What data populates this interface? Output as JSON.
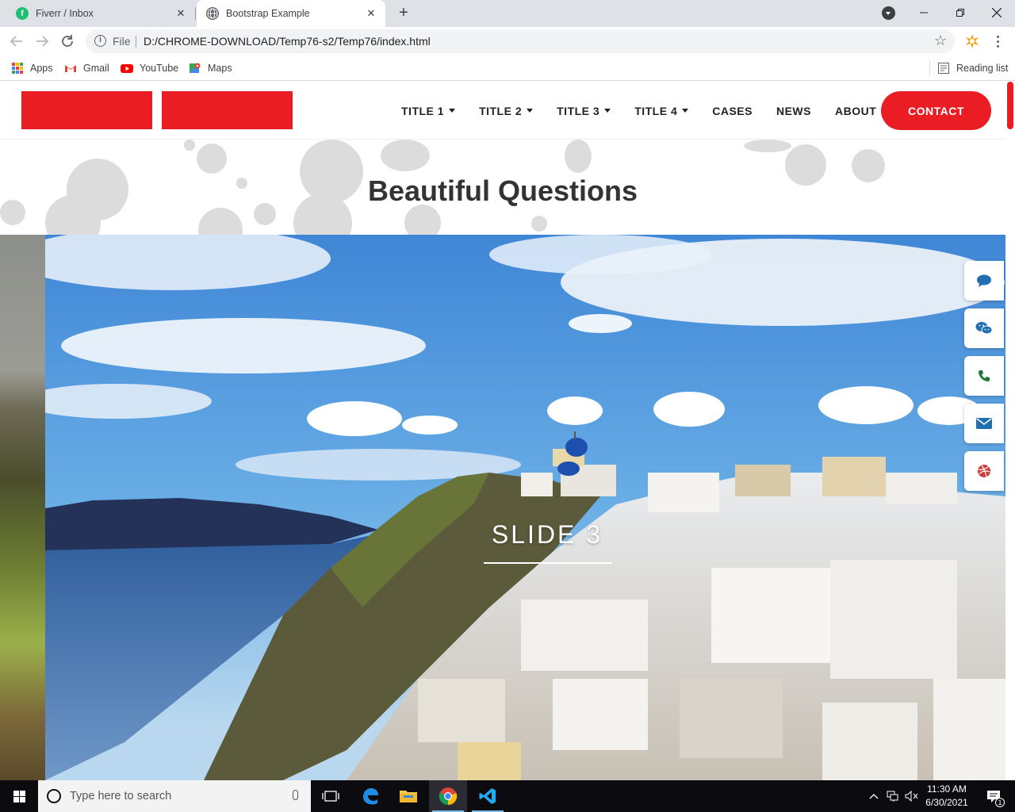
{
  "browser": {
    "tabs": [
      {
        "title": "Fiverr / Inbox",
        "icon": "fiverr-icon"
      },
      {
        "title": "Bootstrap Example",
        "icon": "globe-icon"
      }
    ],
    "address": {
      "scheme_label": "File",
      "url": "D:/CHROME-DOWNLOAD/Temp76-s2/Temp76/index.html"
    },
    "bookmarks": [
      {
        "label": "Apps",
        "icon": "apps-grid-icon"
      },
      {
        "label": "Gmail",
        "icon": "gmail-icon"
      },
      {
        "label": "YouTube",
        "icon": "youtube-icon"
      },
      {
        "label": "Maps",
        "icon": "maps-icon"
      }
    ],
    "reading_list": "Reading list"
  },
  "site": {
    "brand_color": "#ea1c24",
    "nav": [
      {
        "label": "TITLE 1",
        "dropdown": true
      },
      {
        "label": "TITLE 2",
        "dropdown": true
      },
      {
        "label": "TITLE 3",
        "dropdown": true
      },
      {
        "label": "TITLE 4",
        "dropdown": true
      },
      {
        "label": "CASES",
        "dropdown": false
      },
      {
        "label": "NEWS",
        "dropdown": false
      },
      {
        "label": "ABOUT",
        "dropdown": false
      }
    ],
    "contact_label": "CONTACT",
    "section_title": "Beautiful Questions",
    "slide_caption": "SLIDE 3",
    "side_tools": [
      "chat-bubble-icon",
      "wechat-icon",
      "phone-icon",
      "mail-icon",
      "dribbble-icon"
    ]
  },
  "taskbar": {
    "search_placeholder": "Type here to search",
    "time": "11:30 AM",
    "date": "6/30/2021",
    "notification_count": "1",
    "apps": [
      "task-view-icon",
      "edge-icon",
      "file-explorer-icon",
      "chrome-icon",
      "vscode-icon"
    ]
  }
}
